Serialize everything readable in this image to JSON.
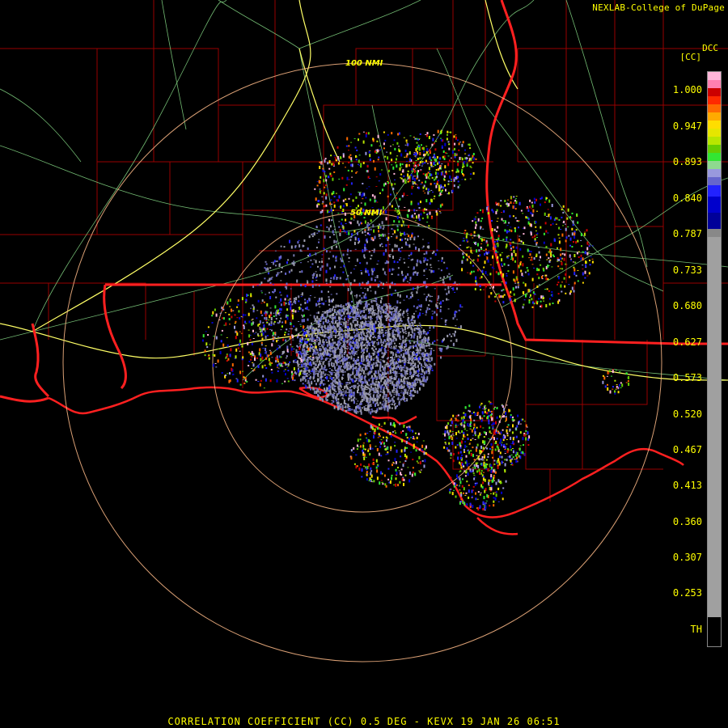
{
  "header": {
    "credit": "NEXLAB-College of DuPage",
    "product_code": "DCC",
    "unit": "[CC]"
  },
  "footer": {
    "caption": "CORRELATION COEFFICIENT (CC) 0.5 DEG - KEVX 19 JAN 26 06:51"
  },
  "range_rings": [
    {
      "label": "100 NMI"
    },
    {
      "label": "50 NMI"
    }
  ],
  "legend": {
    "labels": [
      "1.000",
      "0.947",
      "0.893",
      "0.840",
      "0.787",
      "0.733",
      "0.680",
      "0.627",
      "0.573",
      "0.520",
      "0.467",
      "0.413",
      "0.360",
      "0.307",
      "0.253",
      "TH"
    ],
    "colors": [
      "#ffb6d9",
      "#ff7fb0",
      "#cc0000",
      "#ff2a00",
      "#ff6a00",
      "#ffaa00",
      "#ffdd00",
      "#e6e600",
      "#b8e600",
      "#66cc00",
      "#33e633",
      "#8fd98f",
      "#9999dd",
      "#6666cc",
      "#2222ff",
      "#0000cc",
      "#000099",
      "#888888",
      "#a0a0a0",
      "#000000"
    ]
  },
  "colors": {
    "coast": "#ff2020",
    "county": "#aa0000",
    "highway": "#ffff66",
    "roads": "#88dd88",
    "ring": "#ffbb88",
    "text": "#ffff00"
  }
}
